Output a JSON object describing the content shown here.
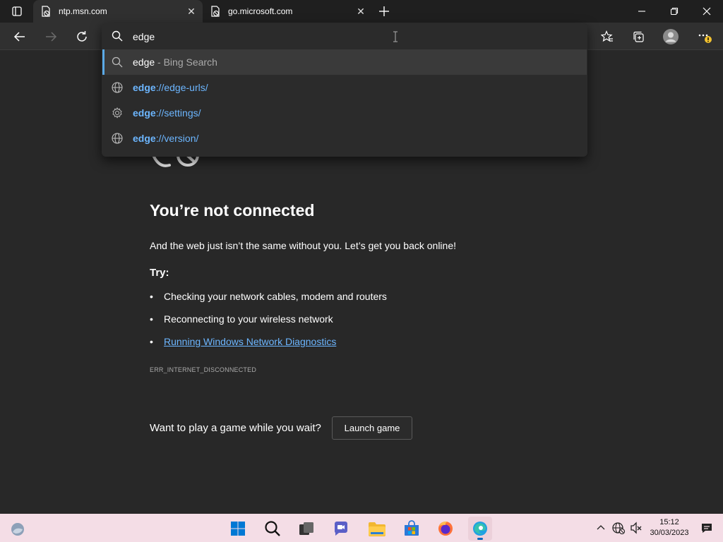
{
  "tabs": [
    {
      "title": "ntp.msn.com",
      "active": true
    },
    {
      "title": "go.microsoft.com",
      "active": false
    }
  ],
  "omnibox": {
    "value": "edge",
    "suggestions": [
      {
        "bold": "edge",
        "rest": " - Bing Search",
        "icon": "search-icon",
        "style": "search"
      },
      {
        "bold": "edge",
        "rest": "://edge-urls/",
        "icon": "globe-icon",
        "style": "link"
      },
      {
        "bold": "edge",
        "rest": "://settings/",
        "icon": "gear-icon",
        "style": "link"
      },
      {
        "bold": "edge",
        "rest": "://version/",
        "icon": "globe-icon",
        "style": "link"
      }
    ]
  },
  "page": {
    "heading": "You’re not connected",
    "subtext": "And the web just isn’t the same without you. Let’s get you back online!",
    "try_label": "Try:",
    "bullets": [
      "Checking your network cables, modem and routers",
      "Reconnecting to your wireless network"
    ],
    "diagnostics_link": "Running Windows Network Diagnostics",
    "error_code": "ERR_INTERNET_DISCONNECTED",
    "game_prompt": "Want to play a game while you wait?",
    "launch_button": "Launch game"
  },
  "taskbar": {
    "time": "15:12",
    "date": "30/03/2023"
  },
  "colors": {
    "accent_link": "#6cb6ff",
    "page_bg": "#282828",
    "taskbar_bg": "#f4dde6"
  }
}
